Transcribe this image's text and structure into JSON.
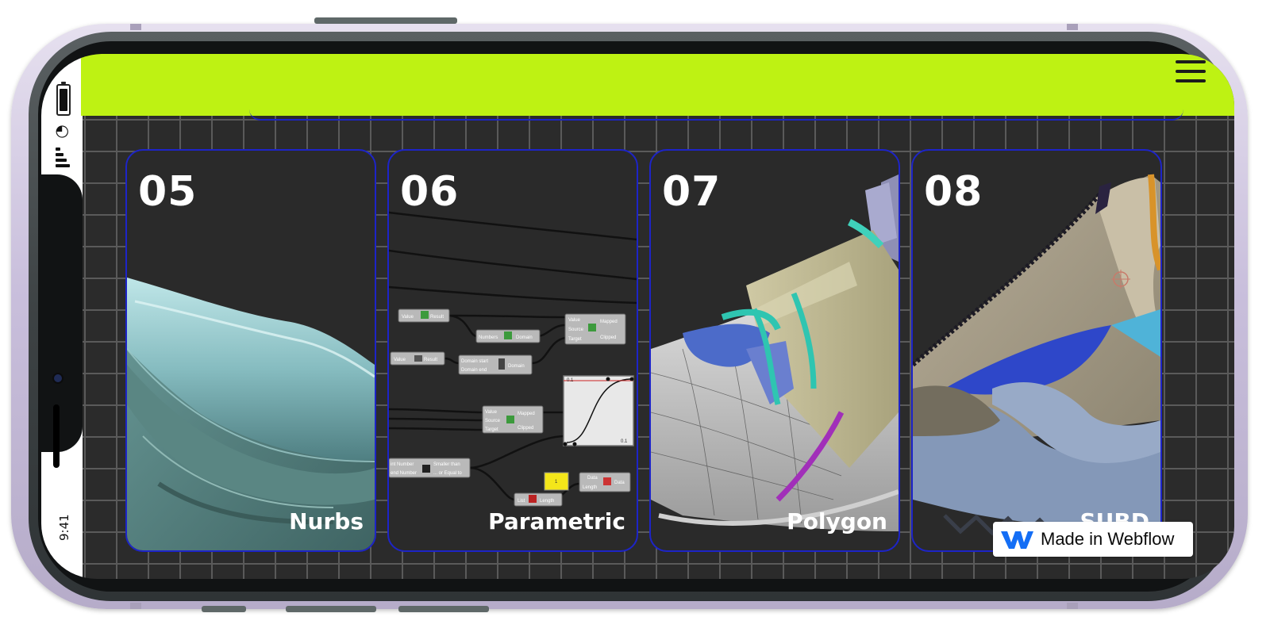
{
  "status_bar": {
    "time": "9:41"
  },
  "header": {
    "background_color": "#bef213",
    "menu_icon": "hamburger-menu-icon"
  },
  "cards": [
    {
      "number": "05",
      "label": "Nurbs"
    },
    {
      "number": "06",
      "label": "Parametric"
    },
    {
      "number": "07",
      "label": "Polygon"
    },
    {
      "number": "08",
      "label": "SUBD"
    }
  ],
  "grasshopper_nodes": {
    "n1_left": "Value",
    "n1_right": "Result",
    "n2_left": "Numbers",
    "n2_right": "Domain",
    "n3_in1": "Value",
    "n3_in2": "Source",
    "n3_in3": "Target",
    "n3_out1": "Mapped",
    "n3_out2": "Clipped",
    "n4_left": "Value",
    "n4_right": "Result",
    "n5_in1": "Domain start",
    "n5_in2": "Domain end",
    "n5_right": "Domain",
    "n6_in1": "Value",
    "n6_in2": "Source",
    "n6_in3": "Target",
    "n6_out1": "Mapped",
    "n6_out2": "Clipped",
    "graph_top_label": "0.1",
    "graph_bottom_label": "0.1",
    "n7_in1": "int Number",
    "n7_in2": "end Number",
    "n7_out1": "Smaller than",
    "n7_out2": "... or Equal to",
    "n8_value": "1",
    "n9_in1": "Data",
    "n9_in2": "Length",
    "n9_right": "Data",
    "n10_left": "List",
    "n10_right": "Length"
  },
  "badge": {
    "text": "Made in Webflow",
    "accent_color": "#146ef5"
  },
  "colors": {
    "card_border": "#1d24c8",
    "grid_bg": "#2b2b2b",
    "grid_line": "#5a5a5a"
  }
}
